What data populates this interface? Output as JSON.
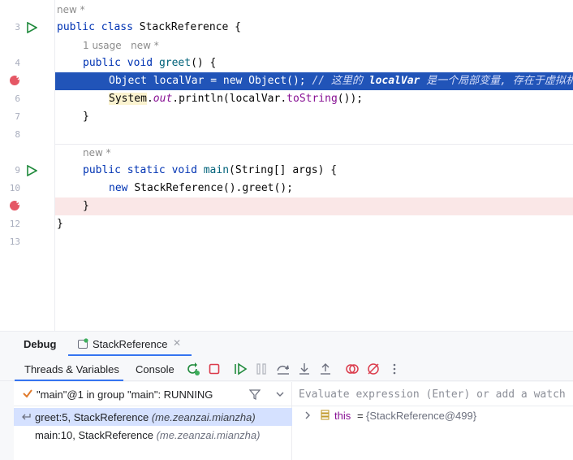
{
  "editor": {
    "hints": {
      "class_meta": "new *",
      "greet_usage": "1 usage",
      "greet_meta": "new *",
      "main_meta": "new *"
    },
    "line_numbers": [
      "3",
      "4",
      "5",
      "6",
      "7",
      "8",
      "9",
      "10",
      "11",
      "12",
      "13"
    ],
    "lines": {
      "l3": {
        "kw": "public class ",
        "name": "StackReference",
        "rest": " {"
      },
      "l4": {
        "kw1": "public ",
        "kw2": "void ",
        "name": "greet",
        "rest": "() {"
      },
      "l5": {
        "code": "Object localVar = new Object(); ",
        "comment_prefix": "// 这里的 ",
        "comment_var": "localVar",
        "comment_suffix": " 是一个局部变量, 存在于虚拟机"
      },
      "l6": {
        "sys": "System",
        "dot": ".",
        "out": "out",
        "call": ".println(localVar.",
        "tostr": "toString",
        "rest": "());"
      },
      "l7": {
        "code": "}"
      },
      "l9": {
        "kw1": "public ",
        "kw2": "static ",
        "kw3": "void ",
        "name": "main",
        "rest": "(String[] args) {"
      },
      "l10": {
        "kw": "new ",
        "rest": "StackReference().greet();"
      },
      "l11": {
        "code": "}"
      },
      "l12": {
        "code": "}"
      }
    },
    "colors": {
      "execution_line": "#2154b8",
      "breakpoint_line": "#fae7e7",
      "breakpoint": "#e55765",
      "run_gutter": "#208a3c"
    }
  },
  "debug": {
    "tool_title": "Debug",
    "session_tab": "StackReference",
    "tabs": [
      "Threads & Variables",
      "Console"
    ],
    "active_tab": "Threads & Variables",
    "toolbar_icons": [
      "rerun-icon",
      "stop-icon",
      "resume-icon",
      "pause-icon",
      "step-over-icon",
      "step-into-icon",
      "step-out-icon",
      "view-breakpoints-icon",
      "mute-breakpoints-icon",
      "more-icon"
    ],
    "thread": "\"main\"@1 in group \"main\": RUNNING",
    "frames": [
      {
        "method": "greet:5, StackReference ",
        "package": "(me.zeanzai.mianzha)",
        "selected": true
      },
      {
        "method": "main:10, StackReference ",
        "package": "(me.zeanzai.mianzha)",
        "selected": false
      }
    ],
    "evaluate_placeholder": "Evaluate expression (Enter) or add a watch",
    "variables": [
      {
        "name": "this",
        "eq": "=",
        "value": "{StackReference@499}"
      }
    ]
  }
}
